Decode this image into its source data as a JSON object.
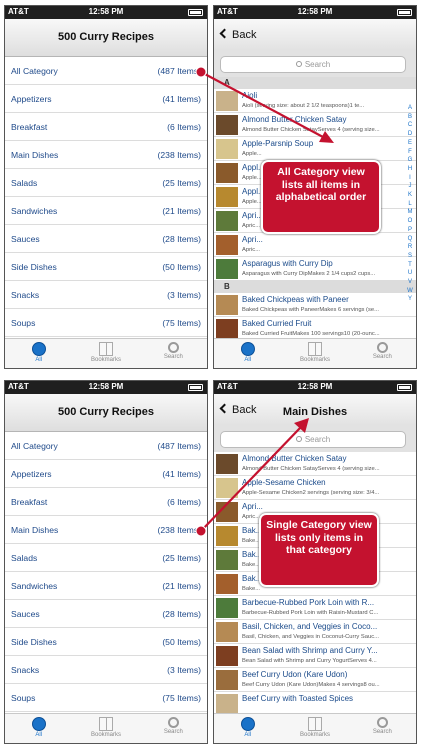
{
  "status": {
    "carrier": "AT&T",
    "time": "12:58 PM"
  },
  "categories_screen": {
    "title": "500 Curry Recipes",
    "items": [
      {
        "name": "All Category",
        "count": "(487 Items)"
      },
      {
        "name": "Appetizers",
        "count": "(41 Items)"
      },
      {
        "name": "Breakfast",
        "count": "(6 Items)"
      },
      {
        "name": "Main Dishes",
        "count": "(238 Items)"
      },
      {
        "name": "Salads",
        "count": "(25 Items)"
      },
      {
        "name": "Sandwiches",
        "count": "(21 Items)"
      },
      {
        "name": "Sauces",
        "count": "(28 Items)"
      },
      {
        "name": "Side Dishes",
        "count": "(50 Items)"
      },
      {
        "name": "Snacks",
        "count": "(3 Items)"
      },
      {
        "name": "Soups",
        "count": "(75 Items)"
      }
    ]
  },
  "tabs": [
    {
      "label": "All",
      "icon": "globe-icon"
    },
    {
      "label": "Bookmarks",
      "icon": "bookmarks-icon"
    },
    {
      "label": "Search",
      "icon": "search-icon"
    }
  ],
  "all_list": {
    "back": "Back",
    "title": "",
    "search_placeholder": "Search",
    "sections": [
      {
        "letter": "A",
        "items": [
          {
            "name": "Aioli",
            "sub": "Aioli (serving size: about 2 1/2 teaspoons)1 te..."
          },
          {
            "name": "Almond Butter Chicken Satay",
            "sub": "Almond Butter Chicken SatayServes 4 (serving size..."
          },
          {
            "name": "Apple-Parsnip Soup",
            "sub": "Apple..."
          },
          {
            "name": "Appl...",
            "sub": "Apple..."
          },
          {
            "name": "Appl...",
            "sub": "Apple..."
          },
          {
            "name": "Apri...",
            "sub": "Apric..."
          },
          {
            "name": "Apri...",
            "sub": "Apric..."
          },
          {
            "name": "Asparagus with Curry Dip",
            "sub": "Asparagus with Curry DipMakes 2 1/4 cups2 cups..."
          }
        ]
      },
      {
        "letter": "B",
        "items": [
          {
            "name": "Baked Chickpeas with Paneer",
            "sub": "Baked Chickpeas with PaneerMakes 6 servings (se..."
          },
          {
            "name": "Baked Curried Fruit",
            "sub": "Baked Curried FruitMakes 100 servings10 (20-ounc..."
          },
          {
            "name": "Baked Curry Glazed Chicken",
            "sub": ""
          }
        ]
      }
    ],
    "index_letters": [
      "A",
      "B",
      "C",
      "D",
      "E",
      "F",
      "G",
      "H",
      "I",
      "J",
      "K",
      "L",
      "M",
      "O",
      "P",
      "Q",
      "R",
      "S",
      "T",
      "U",
      "V",
      "W",
      "Y"
    ]
  },
  "main_list": {
    "back": "Back",
    "title": "Main Dishes",
    "search_placeholder": "Search",
    "items": [
      {
        "name": "Almond Butter Chicken Satay",
        "sub": "Almond Butter Chicken SatayServes 4 (serving size..."
      },
      {
        "name": "Apple-Sesame Chicken",
        "sub": "Apple-Sesame Chicken2 servings (serving size: 3/4..."
      },
      {
        "name": "Apri...",
        "sub": "Apric..."
      },
      {
        "name": "Bak...",
        "sub": "Bake..."
      },
      {
        "name": "Bak...",
        "sub": "Bake..."
      },
      {
        "name": "Bak...",
        "sub": "Bake..."
      },
      {
        "name": "Barbecue-Rubbed Pork Loin with R...",
        "sub": "Barbecue-Rubbed Pork Loin with Raisin-Mustard C..."
      },
      {
        "name": "Basil, Chicken, and Veggies in Coco...",
        "sub": "Basil, Chicken, and Veggies in Coconut-Curry Sauc..."
      },
      {
        "name": "Bean Salad with Shrimp and Curry Y...",
        "sub": "Bean Salad with Shrimp and Curry YogurtServes 4..."
      },
      {
        "name": "Beef Curry Udon (Kare Udon)",
        "sub": "Beef Curry Udon (Kare Udon)Makes 4 servings8 ou..."
      },
      {
        "name": "Beef Curry with Toasted Spices",
        "sub": ""
      }
    ]
  },
  "callouts": {
    "all": "All Category view lists all items in alphabetical order",
    "single": "Single Category view lists only items in that category"
  },
  "colors": {
    "callout": "#c4122f",
    "link": "#1f4a8a",
    "tab_active": "#1a72c8"
  }
}
